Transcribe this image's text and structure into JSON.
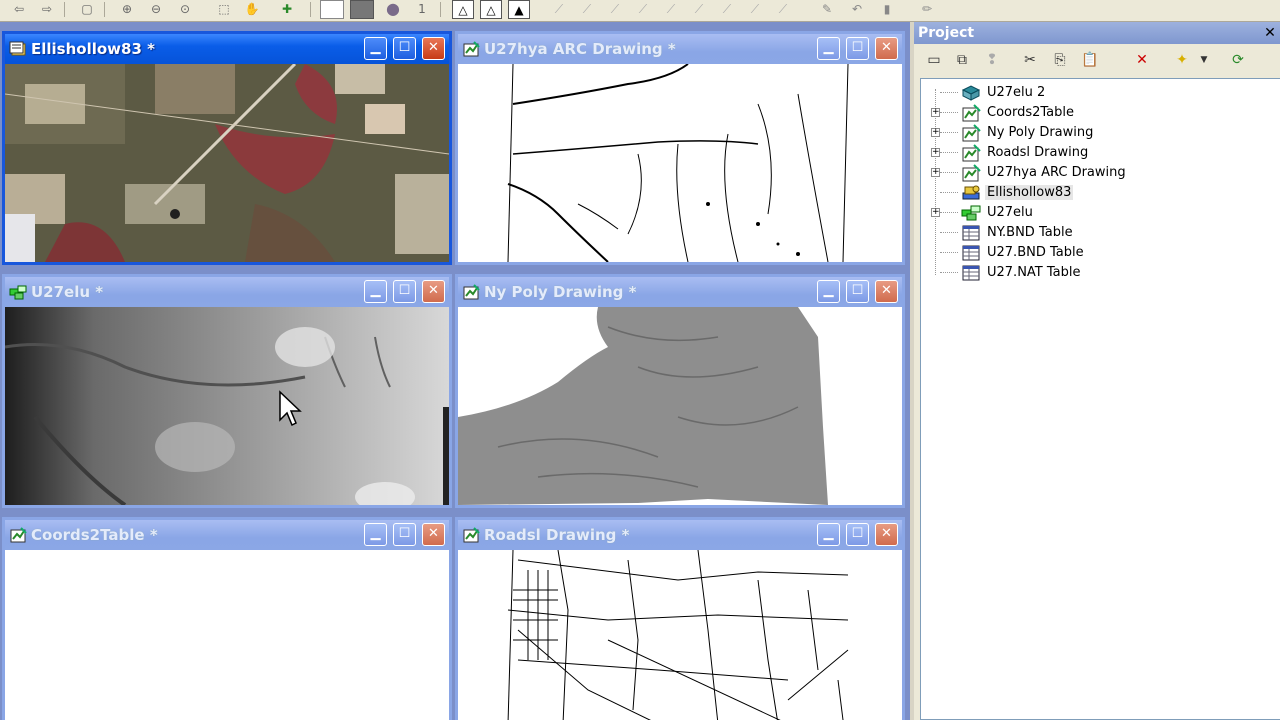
{
  "toolbar": {
    "zoom_value": "1"
  },
  "windows": {
    "w1": {
      "title": "Ellishollow83 *"
    },
    "w2": {
      "title": "U27hya ARC Drawing *"
    },
    "w3": {
      "title": "U27elu *"
    },
    "w4": {
      "title": "Ny Poly Drawing *"
    },
    "w5": {
      "title": "Coords2Table *"
    },
    "w6": {
      "title": "Roadsl Drawing *"
    }
  },
  "project": {
    "title": "Project",
    "items": [
      {
        "label": "U27elu 2"
      },
      {
        "label": "Coords2Table"
      },
      {
        "label": "Ny Poly Drawing"
      },
      {
        "label": "Roadsl Drawing"
      },
      {
        "label": "U27hya ARC Drawing"
      },
      {
        "label": "Ellishollow83"
      },
      {
        "label": "U27elu"
      },
      {
        "label": "NY.BND Table"
      },
      {
        "label": "U27.BND Table"
      },
      {
        "label": "U27.NAT Table"
      }
    ]
  },
  "colors": {
    "active_title": "#0653d9",
    "inactive_title": "#8aa6e6",
    "mdi_background": "#7b8fc9"
  }
}
